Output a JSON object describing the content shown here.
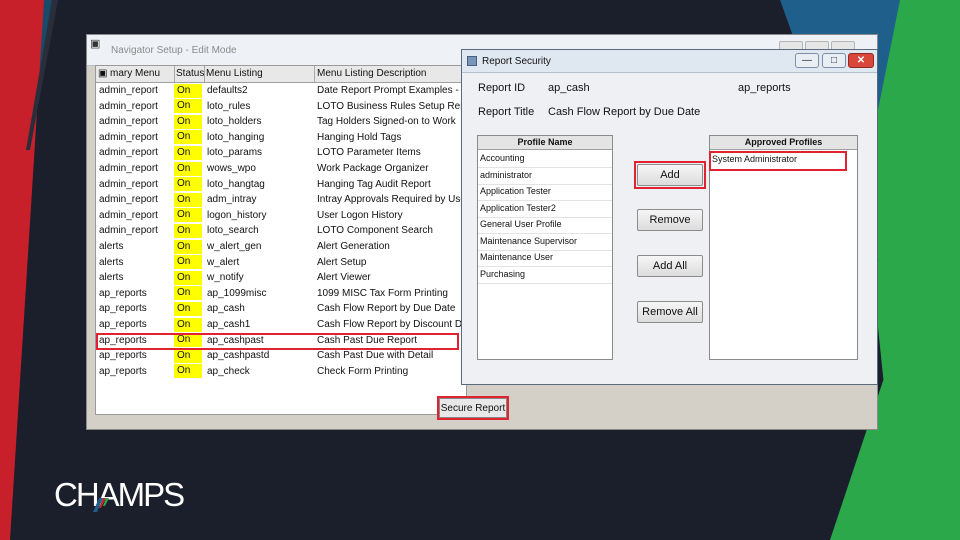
{
  "navigator": {
    "title": "Navigator Setup - Edit Mode",
    "columns": [
      "mary Menu",
      "Status",
      "Menu Listing",
      "Menu Listing Description"
    ],
    "rows": [
      [
        "admin_report",
        "On",
        "defaults2",
        "Date Report Prompt Examples -"
      ],
      [
        "admin_report",
        "On",
        "loto_rules",
        "LOTO Business Rules Setup Repo"
      ],
      [
        "admin_report",
        "On",
        "loto_holders",
        "Tag Holders Signed-on to Work"
      ],
      [
        "admin_report",
        "On",
        "loto_hanging",
        "Hanging Hold Tags"
      ],
      [
        "admin_report",
        "On",
        "loto_params",
        "LOTO Parameter Items"
      ],
      [
        "admin_report",
        "On",
        "wows_wpo",
        "Work Package Organizer"
      ],
      [
        "admin_report",
        "On",
        "loto_hangtag",
        "Hanging Tag Audit Report"
      ],
      [
        "admin_report",
        "On",
        "adm_intray",
        "Intray Approvals Required by User"
      ],
      [
        "admin_report",
        "On",
        "logon_history",
        "User Logon History"
      ],
      [
        "admin_report",
        "On",
        "loto_search",
        "LOTO Component Search"
      ],
      [
        "alerts",
        "On",
        "w_alert_gen",
        "Alert Generation"
      ],
      [
        "alerts",
        "On",
        "w_alert",
        "Alert Setup"
      ],
      [
        "alerts",
        "On",
        "w_notify",
        "Alert Viewer"
      ],
      [
        "ap_reports",
        "On",
        "ap_1099misc",
        "1099 MISC Tax Form Printing"
      ],
      [
        "ap_reports",
        "On",
        "ap_cash",
        "Cash Flow Report by Due Date"
      ],
      [
        "ap_reports",
        "On",
        "ap_cash1",
        "Cash Flow Report by Discount Date"
      ],
      [
        "ap_reports",
        "On",
        "ap_cashpast",
        "Cash Past Due Report"
      ],
      [
        "ap_reports",
        "On",
        "ap_cashpastd",
        "Cash Past Due with Detail"
      ],
      [
        "ap_reports",
        "On",
        "ap_check",
        "Check Form Printing"
      ]
    ],
    "secure_button": "Secure Report"
  },
  "dialog": {
    "title": "Report Security",
    "report_id_label": "Report ID",
    "report_id_value": "ap_cash",
    "group_value": "ap_reports",
    "report_title_label": "Report Title",
    "report_title_value": "Cash Flow Report by Due Date",
    "profile_header": "Profile Name",
    "profiles": [
      "Accounting",
      "administrator",
      "Application Tester",
      "Application Tester2",
      "General User Profile",
      "Maintenance Supervisor",
      "Maintenance User",
      "Purchasing"
    ],
    "approved_header": "Approved Profiles",
    "approved": [
      "System Administrator"
    ],
    "buttons": {
      "add": "Add",
      "remove": "Remove",
      "add_all": "Add All",
      "remove_all": "Remove All"
    }
  },
  "brand": {
    "logo_text": "CHAMPS"
  },
  "colors": {
    "highlight": "#e0232e",
    "status_on": "#ffff00",
    "red_band": "#c8202a",
    "green_band": "#2aa84a",
    "blue_band": "#1e5f8c"
  }
}
